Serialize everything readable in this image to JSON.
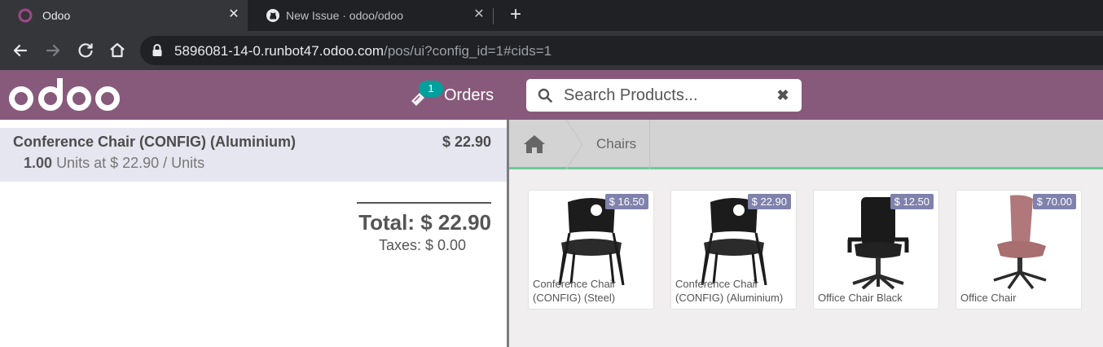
{
  "browser": {
    "tabs": [
      {
        "title": "Odoo",
        "favicon": "odoo-circle-icon",
        "active": true
      },
      {
        "title": "New Issue · odoo/odoo",
        "favicon": "github-icon",
        "active": false
      }
    ],
    "close_glyph": "✕",
    "new_tab_glyph": "+",
    "url_host": "5896081-14-0.runbot47.odoo.com",
    "url_path": "/pos/ui?config_id=1#cids=1"
  },
  "header": {
    "logo_text": "odoo",
    "orders_count": "1",
    "orders_label": "Orders",
    "search_placeholder": "Search Products...",
    "clear_glyph": "✖"
  },
  "order": {
    "lines": [
      {
        "name": "Conference Chair (CONFIG) (Aluminium)",
        "price": "$ 22.90",
        "quantity": "1.00",
        "unit_info": "Units at $ 22.90 / Units"
      }
    ],
    "total": "Total: $ 22.90",
    "taxes": "Taxes: $ 0.00"
  },
  "breadcrumb": {
    "home_icon": "home-icon",
    "category": "Chairs"
  },
  "products": [
    {
      "name": "Conference Chair (CONFIG) (Steel)",
      "price": "$ 16.50",
      "image": "stacking-chair"
    },
    {
      "name": "Conference Chair (CONFIG) (Aluminium)",
      "price": "$ 22.90",
      "image": "stacking-chair"
    },
    {
      "name": "Office Chair Black",
      "price": "$ 12.50",
      "image": "office-chair-black"
    },
    {
      "name": "Office Chair",
      "price": "$ 70.00",
      "image": "office-chair-pink"
    }
  ],
  "colors": {
    "odoo_purple": "#875a7b",
    "badge_teal": "#00a09d",
    "price_tag": "#7f82ac",
    "selected_line": "#e6e6f0",
    "breadcrumb_accent": "#6ec89b"
  }
}
